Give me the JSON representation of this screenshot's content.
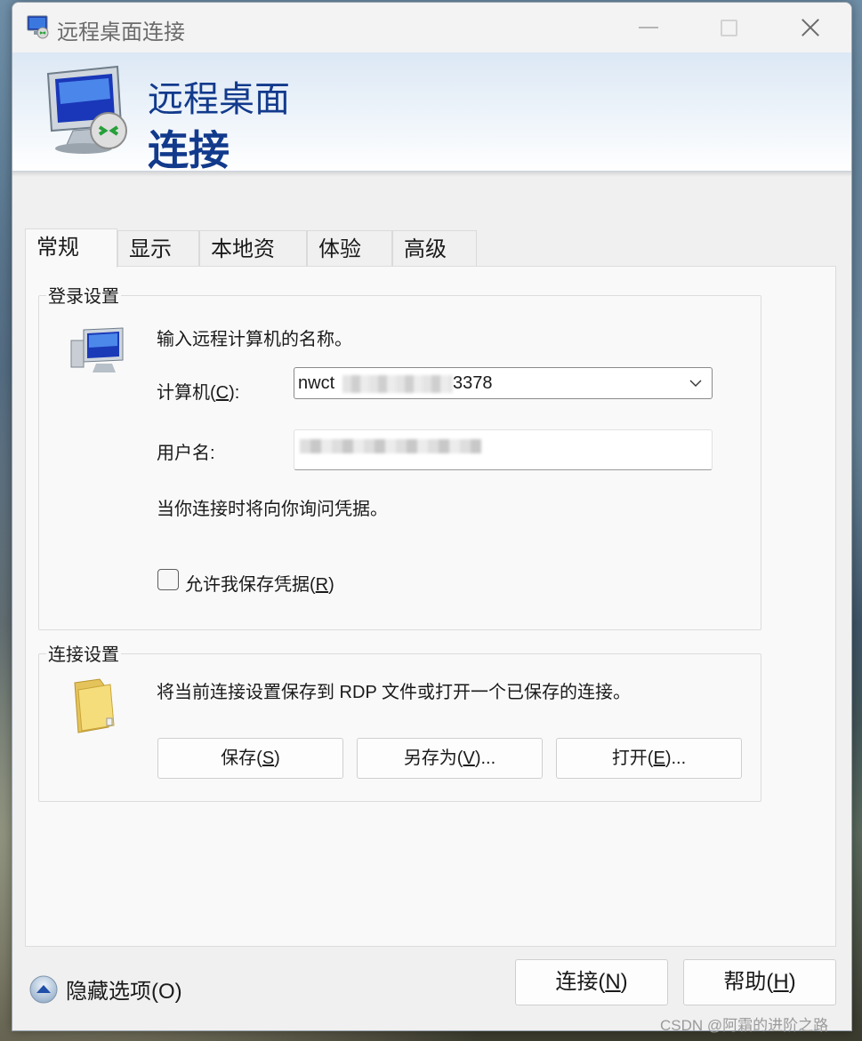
{
  "window": {
    "title": "远程桌面连接",
    "banner_line1": "远程桌面",
    "banner_line2": "连接"
  },
  "tabs": [
    {
      "label": "常规",
      "active": true
    },
    {
      "label": "显示",
      "active": false
    },
    {
      "label": "本地资源",
      "active": false
    },
    {
      "label": "体验",
      "active": false
    },
    {
      "label": "高级",
      "active": false
    }
  ],
  "login": {
    "group_label": "登录设置",
    "intro": "输入远程计算机的名称。",
    "computer_label_prefix": "计算机(",
    "computer_label_key": "C",
    "computer_label_suffix": "):",
    "computer_value_start": "nwct",
    "computer_value_end": "3378",
    "user_label": "用户名:",
    "notice": "当你连接时将向你询问凭据。",
    "remember_prefix": "允许我保存凭据(",
    "remember_key": "R",
    "remember_suffix": ")",
    "remember_checked": false
  },
  "connection": {
    "group_label": "连接设置",
    "description": "将当前连接设置保存到 RDP 文件或打开一个已保存的连接。",
    "save": {
      "prefix": "保存(",
      "key": "S",
      "suffix": ")"
    },
    "save_as": {
      "prefix": "另存为(",
      "key": "V",
      "suffix": ")..."
    },
    "open": {
      "prefix": "打开(",
      "key": "E",
      "suffix": ")..."
    }
  },
  "footer": {
    "hide_options": "隐藏选项(O)",
    "connect": {
      "prefix": "连接(",
      "key": "N",
      "suffix": ")"
    },
    "help": {
      "prefix": "帮助(",
      "key": "H",
      "suffix": ")"
    }
  },
  "watermark": "CSDN @阿霜的进阶之路",
  "colors": {
    "banner_text": "#123a8c",
    "window_bg": "#f0f0f0"
  },
  "icons": {
    "title": "remote-desktop-icon",
    "banner": "remote-desktop-icon",
    "computer": "computer-icon",
    "folder": "folder-icon",
    "hide_options": "chevron-up-icon"
  }
}
